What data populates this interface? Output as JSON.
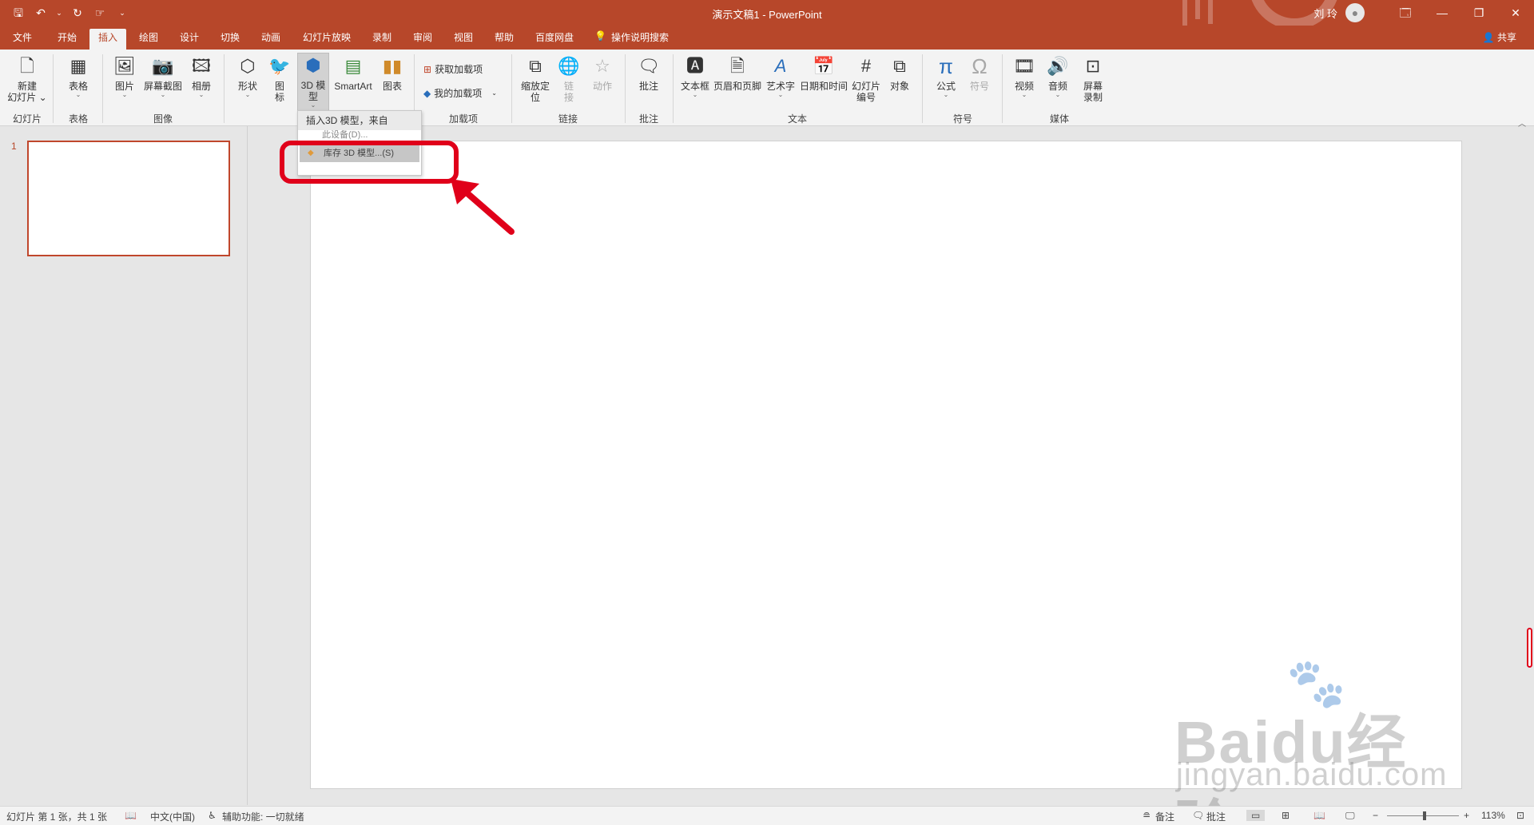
{
  "window": {
    "title": "演示文稿1  -  PowerPoint",
    "user": "刘 玲",
    "qat": {
      "save": "🖫",
      "undo": "↶",
      "undo_dd": "⌄",
      "redo": "↻",
      "touch": "☞",
      "customize": "⌄"
    },
    "buttons": {
      "ribbon_display": "🗔",
      "minimize": "—",
      "restore": "❐",
      "close": "✕"
    }
  },
  "tabs": [
    "文件",
    "开始",
    "插入",
    "绘图",
    "设计",
    "切换",
    "动画",
    "幻灯片放映",
    "录制",
    "审阅",
    "视图",
    "帮助",
    "百度网盘"
  ],
  "tell_me": "操作说明搜索",
  "share": "共享",
  "ribbon": {
    "new_slide": "新建\n幻灯片 ⌄",
    "table": "表格",
    "pictures": "图片",
    "screenshot": "屏幕截图",
    "album": "相册",
    "shapes": "形状",
    "icons": "图\n标",
    "model3d": "3D 模\n型",
    "smartart": "SmartArt",
    "chart": "图表",
    "get_addins": "获取加载项",
    "my_addins": "我的加载项",
    "zoom": "缩放定\n位",
    "link": "链\n接",
    "action": "动作",
    "comment": "批注",
    "textbox": "文本框",
    "header_footer": "页眉和页脚",
    "wordart": "艺术字",
    "datetime": "日期和时间",
    "slide_number": "幻灯片\n编号",
    "object": "对象",
    "equation": "公式",
    "symbol": "符号",
    "video": "视频",
    "audio": "音频",
    "screen_record": "屏幕\n录制",
    "groups": [
      "幻灯片",
      "表格",
      "图像",
      "加载项",
      "链接",
      "批注",
      "文本",
      "符号",
      "媒体"
    ]
  },
  "dropdown": {
    "header": "插入3D 模型，来自",
    "partial_item": "此设备(D)...",
    "item": "库存 3D 模型...(S)"
  },
  "thumbnail": {
    "number": "1"
  },
  "watermark": {
    "main": "Baidu经验",
    "sub": "jingyan.baidu.com"
  },
  "statusbar": {
    "slide_info": "幻灯片 第 1 张，共 1 张",
    "language": "中文(中国)",
    "accessibility": "辅助功能: 一切就绪",
    "notes": "备注",
    "comments": "批注",
    "zoom_level": "113%"
  }
}
